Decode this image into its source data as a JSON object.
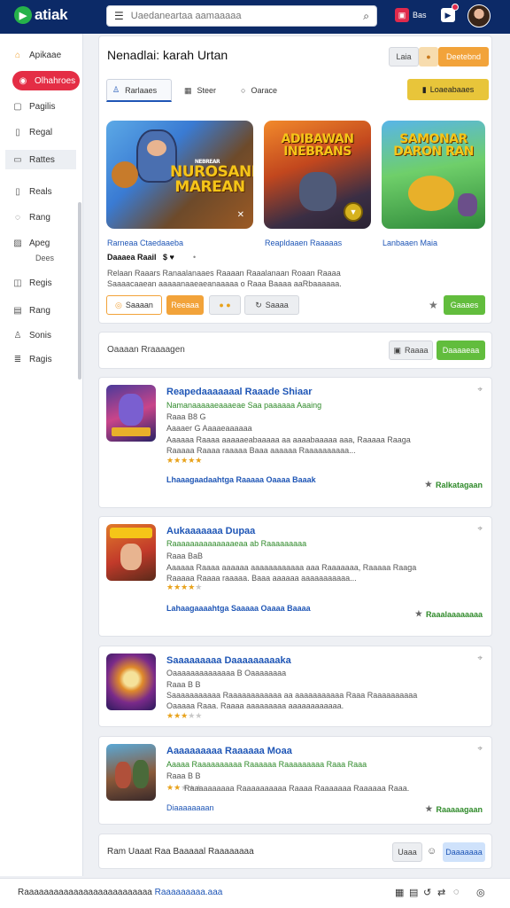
{
  "header": {
    "logo": "atiak",
    "search_placeholder": "Uaedaneartaa aamaaaaa",
    "notif_label": "Bas"
  },
  "sidebar": {
    "items": [
      {
        "label": "Apikaae",
        "icon": "home-icon"
      },
      {
        "label": "Olhahroes",
        "icon": "gamepad-icon"
      },
      {
        "label": "Pagilis",
        "icon": "grid-icon"
      },
      {
        "label": "Regal",
        "icon": "page-icon"
      },
      {
        "label": "Rattes",
        "icon": "folder-icon"
      },
      {
        "label": "Reals",
        "icon": "page-icon"
      },
      {
        "label": "Rang",
        "icon": "chat-icon"
      },
      {
        "label": "Apeg",
        "icon": "image-icon"
      },
      {
        "label": "Regis",
        "icon": "tag-icon"
      },
      {
        "label": "Rang",
        "icon": "list-icon"
      },
      {
        "label": "Sonis",
        "icon": "user-icon"
      },
      {
        "label": "Ragis",
        "icon": "doc-icon"
      }
    ],
    "sub_label": "Dees"
  },
  "featured": {
    "title": "Nenadlai: karah Urtan",
    "btn_small": "Laia",
    "btn_main": "Deetebnd",
    "tabs": [
      "Rarlaaes",
      "Steer",
      "Oarace"
    ],
    "tab_btn": "Loaeabaaes",
    "games": [
      {
        "name": "Rarneaa Ctaedaaeba",
        "art": "NUROSAND MAREAN",
        "art_small": "NEBREAR"
      },
      {
        "name": "Reapldaaen Raaaaas",
        "art": "ADIBAWAN INEBRANS"
      },
      {
        "name": "Lanbaaen Maia",
        "art": "SAMONAR DARON RAN"
      }
    ],
    "meta": "Daaaea Raail",
    "meta_icons": "$ ♥",
    "desc1": "Relaan Raaars Ranaalanaaes Raaaan Raaalanaan Roaan Raaaa",
    "desc2": "Saaaacaaean aaaaanaaeaeanaaaaa o Raaa Baaaa aaRbaaaaaa.",
    "actions": [
      "Saaaan",
      "Reeaaa",
      "Saaaa"
    ],
    "bottom_btn": "Gaaaes"
  },
  "midbar": {
    "label": "Oaaaan Rraaaagen",
    "btn1": "Raaaa",
    "btn2": "Daaaaeaa"
  },
  "list": [
    {
      "title": "Reapedaaaaaaal Raaade Shiaar",
      "sub1": "Namanaaaaaeaaaeae Saa paaaaaa Aaaing",
      "sub2": "Raaa B8 G",
      "sub3": "Aaaaer G  Aaaaeaaaaaa",
      "desc1": "Aaaaaa Raaaa aaaaaeabaaaaa aa aaaabaaaaa aaa, Raaaaa Raaga",
      "desc2": "Raaaaa Raaaa raaaaa Baaa aaaaaa Raaaaaaaaaa...",
      "rating": 5,
      "link": "Lhaaagaadaahtga Raaaaa Oaaaa Baaak",
      "right": "Ralkatagaan"
    },
    {
      "title": "Aukaaaaaaa Dupaa",
      "sub1": "Raaaaaaaaaaaaaaeaa ab Raaaaaaaaa",
      "sub2": "Raaa BaB",
      "sub3": "",
      "desc1": "Aaaaaa Raaaa aaaaaa aaaaaaaaaaaa aaa Raaaaaaa, Raaaaa Raaga",
      "desc2": "Raaaaa Raaaa raaaaa. Baaa aaaaaa aaaaaaaaaaa...",
      "rating": 4,
      "link": "Lahaagaaaahtga Saaaaa Oaaaa Baaaa",
      "right": "Raaalaaaaaaaa"
    },
    {
      "title": "Saaaaaaaaa Daaaaaaaaaka",
      "sub1": "Oaaaaaaaaaaaaaa B Oaaaaaaaa",
      "sub2": "Raaa B B",
      "sub3": "",
      "desc1": "Saaaaaaaaaaa Raaaaaaaaaaaa aa aaaaaaaaaaa Raaa Raaaaaaaaaa",
      "desc2": "Oaaaaa Raaa. Raaaa aaaaaaaaa aaaaaaaaaaaa.",
      "rating": 3,
      "link": "",
      "right": ""
    },
    {
      "title": "Aaaaaaaaaa Raaaaaa Moaa",
      "sub1": "Aaaaa Raaaaaaaaaa Raaaaaa Raaaaaaaaa Raaa Raaa",
      "sub2": "Raaa B B",
      "sub3": "",
      "desc1": "Raaaaaaaaaa Raaaaaaaaaa Raaaa Raaaaaaa Raaaaaa Raaa.",
      "desc2": "",
      "rating": 2,
      "link": "Diaaaaaaaan",
      "right": "Raaaaagaan"
    }
  ],
  "bottom_card": {
    "text": "Ram Uaaat Raa Baaaaal Raaaaaaaa",
    "btn1": "Uaaa",
    "btn2": "Daaaaaaa"
  },
  "footer": {
    "text": "Raaaaaaaaaaaaaaaaaaaaaaaaaa ",
    "link": "Raaaaaaaaa.aaa"
  }
}
